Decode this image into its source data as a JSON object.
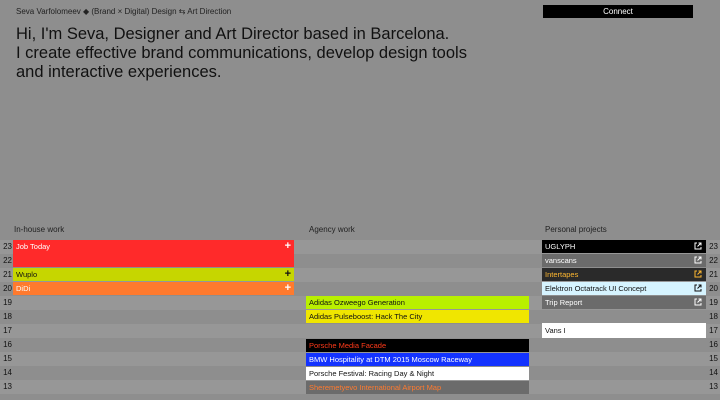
{
  "header": {
    "breadcrumb": "Seva Varfolomeev ◆ (Brand × Digital) Design ⇆ Art Direction",
    "connect_label": "Connect"
  },
  "hero": {
    "line1": "Hi, I'm Seva, Designer and Art Director based in Barcelona.",
    "line2": "I create effective brand communications, develop design tools",
    "line3": "and interactive experiences."
  },
  "columns": {
    "inhouse": "In-house work",
    "agency": "Agency work",
    "personal": "Personal projects"
  },
  "years": [
    "23",
    "22",
    "21",
    "20",
    "19",
    "18",
    "17",
    "16",
    "15",
    "14",
    "13"
  ],
  "inhouse": [
    {
      "label": "Job Today",
      "plus": "+",
      "color": "#ff2a2a",
      "text": "#ffffff"
    },
    {
      "label": "Wuplo",
      "plus": "+",
      "color": "#c6d600",
      "text": "#111111"
    },
    {
      "label": "DiDi",
      "plus": "+",
      "color": "#ff7a2e",
      "text": "#ffffff"
    }
  ],
  "agency": [
    {
      "label": "Adidas Ozweego Generation",
      "color": "#b9f000",
      "text": "#111111"
    },
    {
      "label": "Adidas Pulseboost: Hack The City",
      "color": "#f0e600",
      "text": "#111111"
    },
    {
      "label": "Porsche Media Facade",
      "color": "#000000",
      "text": "#ff3a1a"
    },
    {
      "label": "BMW Hospitality at DTM 2015 Moscow Raceway",
      "color": "#1433ff",
      "text": "#ffffff"
    },
    {
      "label": "Porsche Festival: Racing Day & Night",
      "color": "#ffffff",
      "text": "#111111"
    },
    {
      "label": "Sheremetyevo International Airport Map",
      "color": "#6b6b6b",
      "text": "#ff7a2e"
    }
  ],
  "personal": [
    {
      "label": "UGLYPH",
      "color": "#000000",
      "text": "#ffffff",
      "icon": "external-link-icon"
    },
    {
      "label": "vanscans",
      "color": "#6b6b6b",
      "text": "#ffffff",
      "icon": "external-link-icon"
    },
    {
      "label": "Intertapes",
      "color": "#2a2a2a",
      "text": "#ffb830",
      "icon": "external-link-icon"
    },
    {
      "label": "Elektron Octatrack UI Concept",
      "color": "#d6f4ff",
      "text": "#111111",
      "icon": "external-link-icon"
    },
    {
      "label": "Trip  Report",
      "color": "#6b6b6b",
      "text": "#ffffff",
      "icon": "external-link-icon"
    },
    {
      "label": "Vans I",
      "color": "#ffffff",
      "text": "#111111"
    }
  ]
}
